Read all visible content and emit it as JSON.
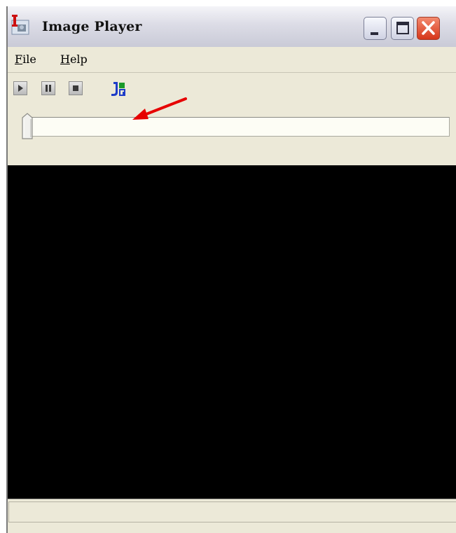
{
  "window": {
    "title": "Image Player",
    "app_icon": "image-player-app-icon",
    "controls": {
      "minimize_icon": "minimize-icon",
      "maximize_icon": "maximize-icon",
      "close_icon": "close-icon"
    }
  },
  "menubar": {
    "items": [
      {
        "label_first": "F",
        "label_rest": "ile"
      },
      {
        "label_first": "H",
        "label_rest": "elp"
      }
    ]
  },
  "toolbar": {
    "buttons": [
      "play-icon",
      "pause-icon",
      "stop-icon",
      "jpg-export-icon"
    ]
  },
  "slider": {
    "position": 0
  },
  "annotation": {
    "arrow_color": "#e60000"
  },
  "colors": {
    "window_bg": "#ece9d8",
    "video_bg": "#000000",
    "close_button": "#d6361a",
    "slider_track": "#fdfdf5"
  }
}
